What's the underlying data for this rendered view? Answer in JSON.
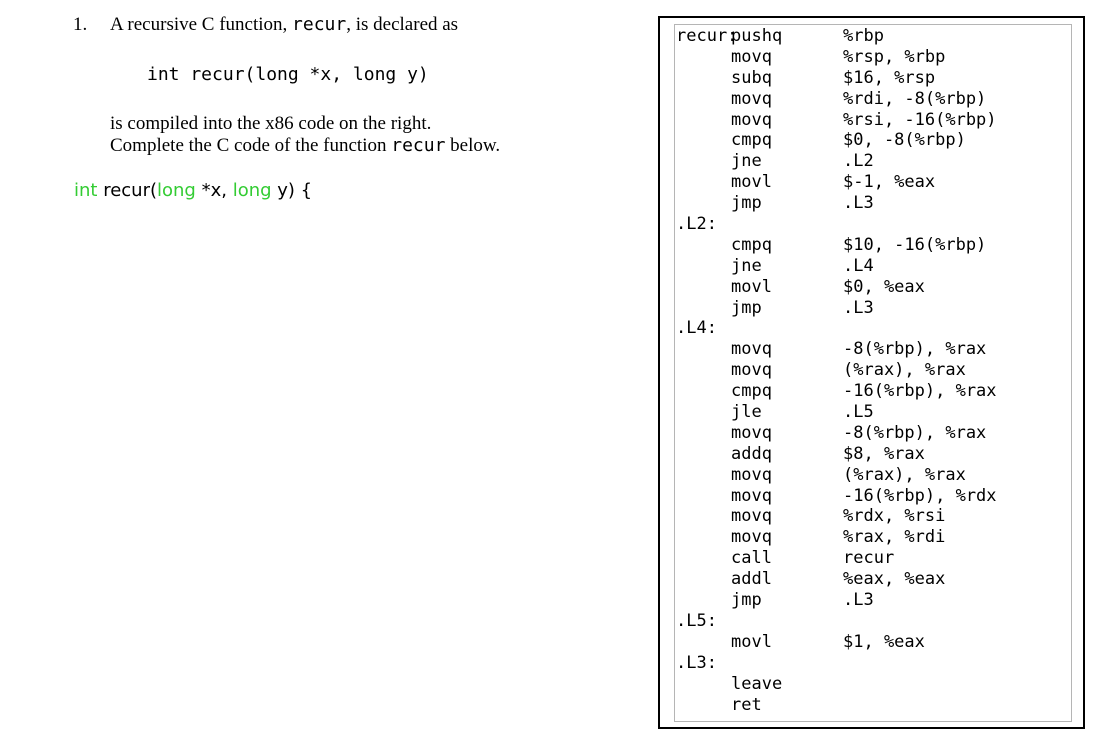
{
  "question": {
    "number": "1.",
    "line1_before": "A recursive C function, ",
    "line1_code": "recur",
    "line1_after": ", is declared as",
    "declaration": "int recur(long *x, long y)",
    "line2": "is compiled into the x86 code on the right.",
    "line3_before": "Complete the C code of the function ",
    "line3_code": "recur",
    "line3_after": " below."
  },
  "code_start": {
    "kw1": "int",
    "text1": " recur(",
    "kw2": "long",
    "text2": " *x, ",
    "kw3": "long",
    "text3": " y) {"
  },
  "asm": [
    {
      "label": "recur:",
      "op": "pushq",
      "args": "%rbp"
    },
    {
      "label": "",
      "op": "movq",
      "args": "%rsp, %rbp"
    },
    {
      "label": "",
      "op": "subq",
      "args": "$16, %rsp"
    },
    {
      "label": "",
      "op": "movq",
      "args": "%rdi, -8(%rbp)"
    },
    {
      "label": "",
      "op": "movq",
      "args": "%rsi, -16(%rbp)"
    },
    {
      "label": "",
      "op": "cmpq",
      "args": "$0, -8(%rbp)"
    },
    {
      "label": "",
      "op": "jne",
      "args": ".L2"
    },
    {
      "label": "",
      "op": "movl",
      "args": "$-1, %eax"
    },
    {
      "label": "",
      "op": "jmp",
      "args": ".L3"
    },
    {
      "label": ".L2:",
      "op": "",
      "args": ""
    },
    {
      "label": "",
      "op": "cmpq",
      "args": "$10, -16(%rbp)"
    },
    {
      "label": "",
      "op": "jne",
      "args": ".L4"
    },
    {
      "label": "",
      "op": "movl",
      "args": "$0, %eax"
    },
    {
      "label": "",
      "op": "jmp",
      "args": ".L3"
    },
    {
      "label": ".L4:",
      "op": "",
      "args": ""
    },
    {
      "label": "",
      "op": "movq",
      "args": "-8(%rbp), %rax"
    },
    {
      "label": "",
      "op": "movq",
      "args": "(%rax), %rax"
    },
    {
      "label": "",
      "op": "cmpq",
      "args": "-16(%rbp), %rax"
    },
    {
      "label": "",
      "op": "jle",
      "args": ".L5"
    },
    {
      "label": "",
      "op": "movq",
      "args": "-8(%rbp), %rax"
    },
    {
      "label": "",
      "op": "addq",
      "args": "$8, %rax"
    },
    {
      "label": "",
      "op": "movq",
      "args": "(%rax), %rax"
    },
    {
      "label": "",
      "op": "movq",
      "args": "-16(%rbp), %rdx"
    },
    {
      "label": "",
      "op": "movq",
      "args": "%rdx, %rsi"
    },
    {
      "label": "",
      "op": "movq",
      "args": "%rax, %rdi"
    },
    {
      "label": "",
      "op": "call",
      "args": "recur"
    },
    {
      "label": "",
      "op": "addl",
      "args": "%eax, %eax"
    },
    {
      "label": "",
      "op": "jmp",
      "args": ".L3"
    },
    {
      "label": ".L5:",
      "op": "",
      "args": ""
    },
    {
      "label": "",
      "op": "movl",
      "args": "$1, %eax"
    },
    {
      "label": ".L3:",
      "op": "",
      "args": ""
    },
    {
      "label": "",
      "op": "leave",
      "args": ""
    },
    {
      "label": "",
      "op": "ret",
      "args": ""
    }
  ]
}
